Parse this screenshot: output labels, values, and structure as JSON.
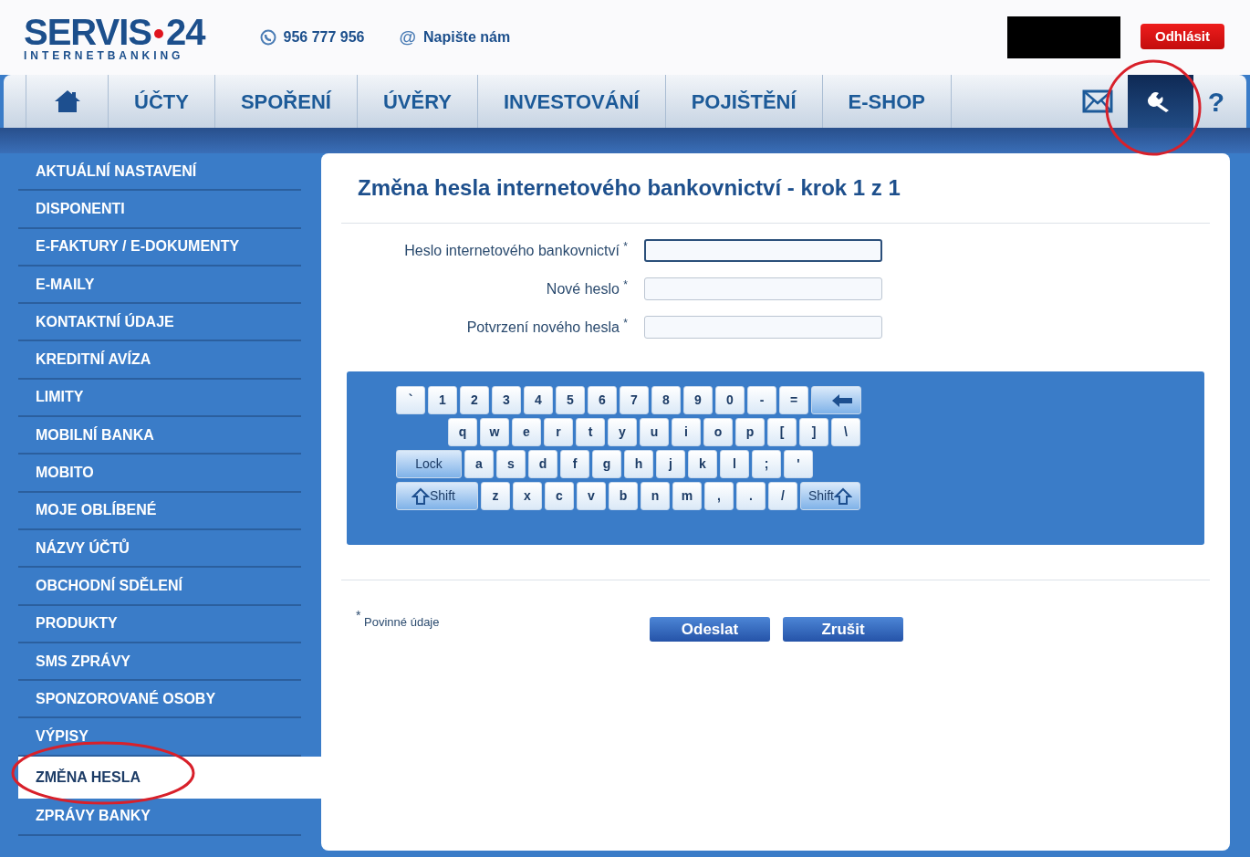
{
  "header": {
    "logo": {
      "name": "SERVIS",
      "number": "24",
      "tagline": "INTERNETBANKING"
    },
    "phone": "956 777 956",
    "contact_icon": "@",
    "contact": "Napište nám",
    "logout": "Odhlásit"
  },
  "nav": {
    "items": [
      {
        "kind": "home",
        "selected": false
      },
      {
        "kind": "text",
        "label": "ÚČTY",
        "selected": false
      },
      {
        "kind": "text",
        "label": "SPOŘENÍ",
        "selected": false
      },
      {
        "kind": "text",
        "label": "ÚVĚRY",
        "selected": false
      },
      {
        "kind": "text",
        "label": "INVESTOVÁNÍ",
        "selected": false
      },
      {
        "kind": "text",
        "label": "POJIŠTĚNÍ",
        "selected": false
      },
      {
        "kind": "text",
        "label": "E-SHOP",
        "selected": false
      }
    ],
    "tools": [
      {
        "kind": "mail",
        "selected": false
      },
      {
        "kind": "settings",
        "selected": true
      },
      {
        "kind": "help",
        "label": "?",
        "selected": false
      }
    ]
  },
  "sidebar": {
    "items": [
      {
        "label": "AKTUÁLNÍ NASTAVENÍ",
        "selected": false
      },
      {
        "label": "DISPONENTI",
        "selected": false
      },
      {
        "label": "E-FAKTURY / E-DOKUMENTY",
        "selected": false
      },
      {
        "label": "E-MAILY",
        "selected": false
      },
      {
        "label": "KONTAKTNÍ ÚDAJE",
        "selected": false
      },
      {
        "label": "KREDITNÍ AVÍZA",
        "selected": false
      },
      {
        "label": "LIMITY",
        "selected": false
      },
      {
        "label": "MOBILNÍ BANKA",
        "selected": false
      },
      {
        "label": "MOBITO",
        "selected": false
      },
      {
        "label": "MOJE OBLÍBENÉ",
        "selected": false
      },
      {
        "label": "NÁZVY ÚČTŮ",
        "selected": false
      },
      {
        "label": "OBCHODNÍ SDĚLENÍ",
        "selected": false
      },
      {
        "label": "PRODUKTY",
        "selected": false
      },
      {
        "label": "SMS ZPRÁVY",
        "selected": false
      },
      {
        "label": "SPONZOROVANÉ OSOBY",
        "selected": false
      },
      {
        "label": "VÝPISY",
        "selected": false
      },
      {
        "label": "ZMĚNA HESLA",
        "selected": true
      },
      {
        "label": "ZPRÁVY BANKY",
        "selected": false
      }
    ]
  },
  "main": {
    "title": "Změna hesla internetového bankovnictví - krok 1 z 1",
    "fields": [
      {
        "label": "Heslo internetového bankovnictví",
        "required": "*",
        "focused": true
      },
      {
        "label": "Nové heslo",
        "required": "*",
        "focused": false
      },
      {
        "label": "Potvrzení nového hesla",
        "required": "*",
        "focused": false
      }
    ],
    "keyboard": {
      "rows": [
        [
          {
            "kind": "char",
            "label": "`"
          },
          {
            "kind": "char",
            "label": "1"
          },
          {
            "kind": "char",
            "label": "2"
          },
          {
            "kind": "char",
            "label": "3"
          },
          {
            "kind": "char",
            "label": "4"
          },
          {
            "kind": "char",
            "label": "5"
          },
          {
            "kind": "char",
            "label": "6"
          },
          {
            "kind": "char",
            "label": "7"
          },
          {
            "kind": "char",
            "label": "8"
          },
          {
            "kind": "char",
            "label": "9"
          },
          {
            "kind": "char",
            "label": "0"
          },
          {
            "kind": "char",
            "label": "-"
          },
          {
            "kind": "char",
            "label": "="
          },
          {
            "kind": "backspace"
          }
        ],
        [
          {
            "kind": "spacer"
          },
          {
            "kind": "char",
            "label": "q"
          },
          {
            "kind": "char",
            "label": "w"
          },
          {
            "kind": "char",
            "label": "e"
          },
          {
            "kind": "char",
            "label": "r"
          },
          {
            "kind": "char",
            "label": "t"
          },
          {
            "kind": "char",
            "label": "y"
          },
          {
            "kind": "char",
            "label": "u"
          },
          {
            "kind": "char",
            "label": "i"
          },
          {
            "kind": "char",
            "label": "o"
          },
          {
            "kind": "char",
            "label": "p"
          },
          {
            "kind": "char",
            "label": "["
          },
          {
            "kind": "char",
            "label": "]"
          },
          {
            "kind": "char",
            "label": "\\"
          }
        ],
        [
          {
            "kind": "lock",
            "label": "Lock"
          },
          {
            "kind": "char",
            "label": "a"
          },
          {
            "kind": "char",
            "label": "s"
          },
          {
            "kind": "char",
            "label": "d"
          },
          {
            "kind": "char",
            "label": "f"
          },
          {
            "kind": "char",
            "label": "g"
          },
          {
            "kind": "char",
            "label": "h"
          },
          {
            "kind": "char",
            "label": "j"
          },
          {
            "kind": "char",
            "label": "k"
          },
          {
            "kind": "char",
            "label": "l"
          },
          {
            "kind": "char",
            "label": ";"
          },
          {
            "kind": "char",
            "label": "'"
          }
        ],
        [
          {
            "kind": "shift-left",
            "label": "Shift"
          },
          {
            "kind": "char",
            "label": "z"
          },
          {
            "kind": "char",
            "label": "x"
          },
          {
            "kind": "char",
            "label": "c"
          },
          {
            "kind": "char",
            "label": "v"
          },
          {
            "kind": "char",
            "label": "b"
          },
          {
            "kind": "char",
            "label": "n"
          },
          {
            "kind": "char",
            "label": "m"
          },
          {
            "kind": "char",
            "label": ","
          },
          {
            "kind": "char",
            "label": "."
          },
          {
            "kind": "char",
            "label": "/"
          },
          {
            "kind": "shift-right",
            "label": "Shift"
          }
        ]
      ]
    },
    "required_note": {
      "mark": "*",
      "text": "Povinné údaje"
    },
    "buttons": [
      "Odeslat",
      "Zrušit"
    ]
  }
}
